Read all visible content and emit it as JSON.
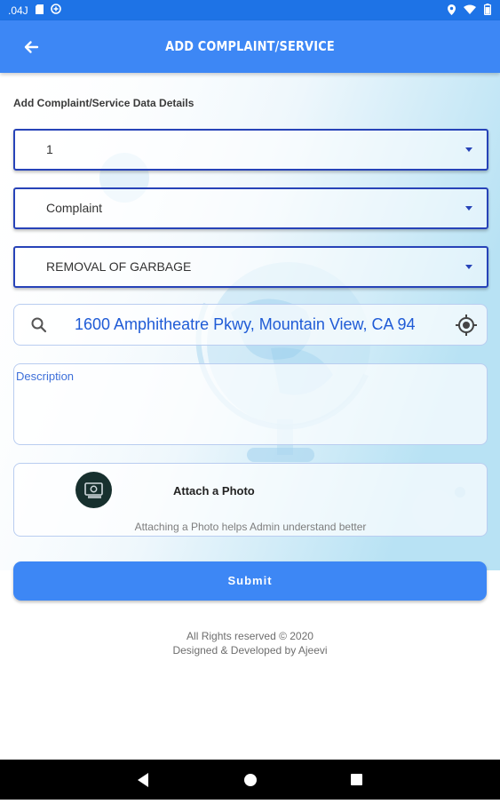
{
  "status_bar": {
    "time": ".04J",
    "left_icons": [
      "sim-icon",
      "data-saver-icon"
    ],
    "right_icons": [
      "location-icon",
      "wifi-icon",
      "battery-icon"
    ]
  },
  "app_bar": {
    "title": "ADD COMPLAINT/SERVICE",
    "back_icon": "arrow-left-icon"
  },
  "form": {
    "section_label": "Add Complaint/Service Data Details",
    "dropdowns": [
      {
        "value": "1"
      },
      {
        "value": "Complaint"
      },
      {
        "value": "REMOVAL OF GARBAGE"
      }
    ],
    "location": {
      "value": "1600 Amphitheatre Pkwy, Mountain View, CA 94",
      "icon": "search-icon",
      "action_icon": "my-location-icon"
    },
    "description": {
      "label": "Description"
    },
    "attach": {
      "title": "Attach a Photo",
      "subtitle": "Attaching a Photo helps Admin understand better",
      "icon": "camera-photo-icon"
    },
    "submit_label": "Submit"
  },
  "footer": {
    "line1": "All Rights reserved © 2020",
    "line2": "Designed & Developed by Ajeevi"
  },
  "nav_bar": {
    "icons": [
      "back-triangle-icon",
      "home-circle-icon",
      "recents-square-icon"
    ]
  },
  "colors": {
    "primary": "#3d87f5",
    "status_bar": "#1e73e6",
    "dropdown_border": "#2743b8",
    "link_text": "#1f5bd6"
  }
}
